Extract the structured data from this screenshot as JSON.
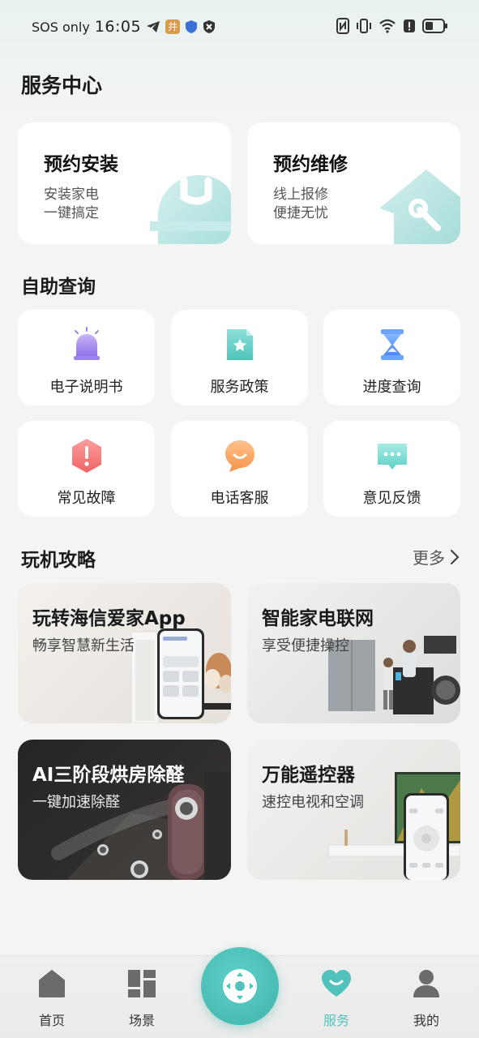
{
  "status_bar": {
    "carrier": "SOS only",
    "time": "16:05",
    "badge_text": "井"
  },
  "page_title": "服务中心",
  "service_cards": [
    {
      "title": "预约安装",
      "line1": "安装家电",
      "line2": "一键搞定",
      "icon": "helmet-icon"
    },
    {
      "title": "预约维修",
      "line1": "线上报修",
      "line2": "便捷无忧",
      "icon": "house-wrench-icon"
    }
  ],
  "self_help": {
    "title": "自助查询",
    "items": [
      {
        "label": "电子说明书",
        "icon": "alarm-light-icon"
      },
      {
        "label": "服务政策",
        "icon": "policy-document-icon"
      },
      {
        "label": "进度查询",
        "icon": "hourglass-icon"
      },
      {
        "label": "常见故障",
        "icon": "warning-hexagon-icon"
      },
      {
        "label": "电话客服",
        "icon": "chat-bubble-smile-icon"
      },
      {
        "label": "意见反馈",
        "icon": "feedback-message-icon"
      }
    ]
  },
  "guides": {
    "title": "玩机攻略",
    "more_label": "更多",
    "items": [
      {
        "title": "玩转海信爱家App",
        "subtitle": "畅享智慧新生活"
      },
      {
        "title": "智能家电联网",
        "subtitle": "享受便捷操控"
      },
      {
        "title": "AI三阶段烘房除醛",
        "subtitle": "一键加速除醛"
      },
      {
        "title": "万能遥控器",
        "subtitle": "速控电视和空调"
      }
    ]
  },
  "tabbar": {
    "items": [
      {
        "label": "首页",
        "icon": "home-icon"
      },
      {
        "label": "场景",
        "icon": "scene-grid-icon"
      },
      {
        "label": "服务",
        "icon": "heart-smile-icon",
        "active": true
      },
      {
        "label": "我的",
        "icon": "user-icon"
      }
    ],
    "center_icon": "remote-dpad-icon"
  },
  "colors": {
    "accent": "#4fc3bb",
    "card_bg": "#ffffff",
    "page_bg": "#f4f4f4"
  }
}
